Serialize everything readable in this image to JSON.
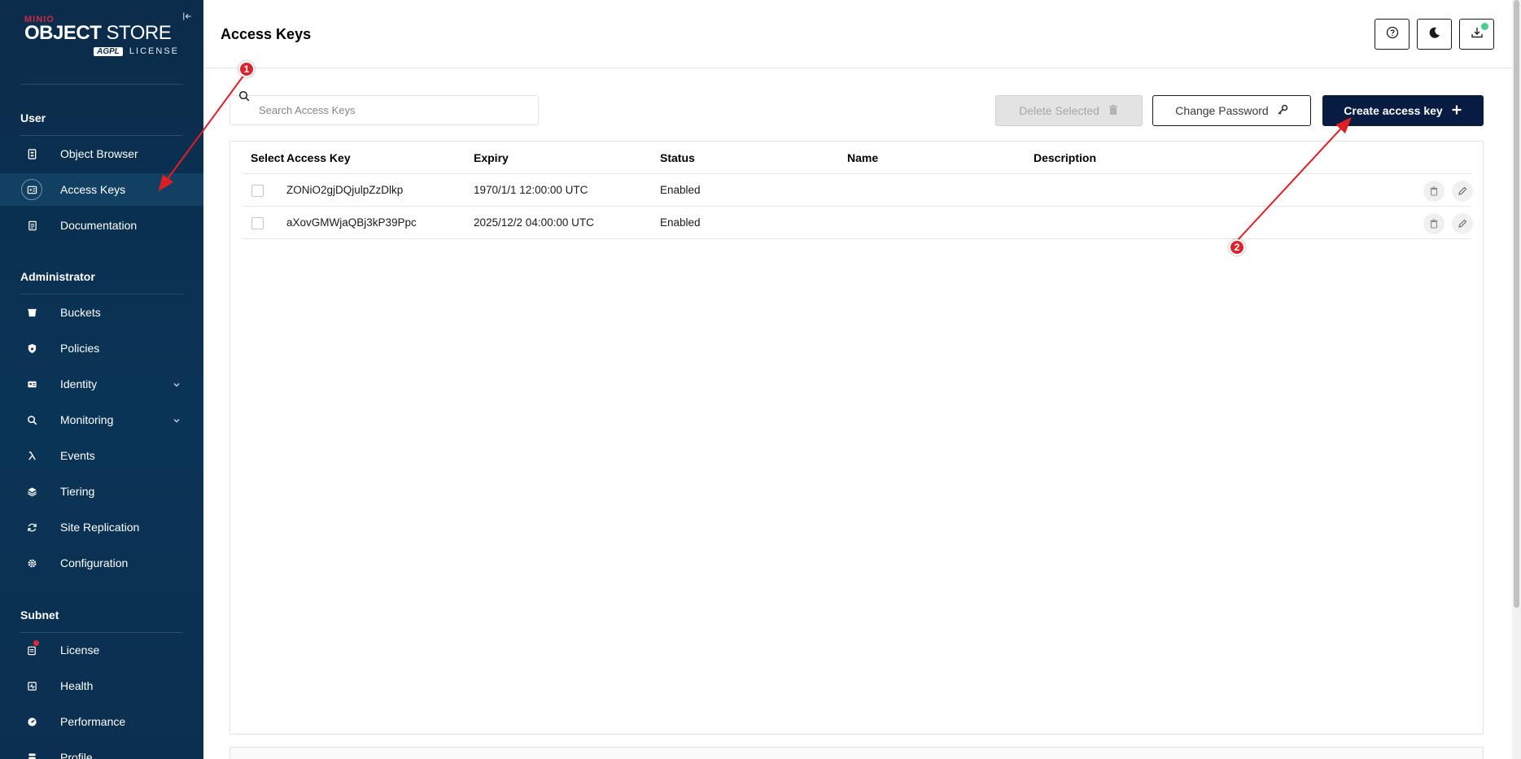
{
  "sidebar": {
    "logo": {
      "brand": "MINIO",
      "title_bold": "OBJECT",
      "title_thin": "STORE",
      "license_badge": "AGPL",
      "license_text": "LICENSE"
    },
    "sections": [
      {
        "title": "User"
      },
      {
        "title": "Administrator"
      },
      {
        "title": "Subnet"
      }
    ],
    "items": [
      {
        "label": "Object Browser",
        "icon": "object-browser-icon"
      },
      {
        "label": "Access Keys",
        "icon": "access-keys-icon",
        "active": true
      },
      {
        "label": "Documentation",
        "icon": "documentation-icon"
      },
      {
        "label": "Buckets",
        "icon": "buckets-icon"
      },
      {
        "label": "Policies",
        "icon": "policies-icon"
      },
      {
        "label": "Identity",
        "icon": "identity-icon",
        "expandable": true
      },
      {
        "label": "Monitoring",
        "icon": "monitoring-icon",
        "expandable": true
      },
      {
        "label": "Events",
        "icon": "lambda-icon"
      },
      {
        "label": "Tiering",
        "icon": "tiering-icon"
      },
      {
        "label": "Site Replication",
        "icon": "site-replication-icon"
      },
      {
        "label": "Configuration",
        "icon": "gear-icon"
      },
      {
        "label": "License",
        "icon": "license-icon",
        "notification": true
      },
      {
        "label": "Health",
        "icon": "health-icon"
      },
      {
        "label": "Performance",
        "icon": "performance-icon"
      },
      {
        "label": "Profile",
        "icon": "profile-icon"
      }
    ]
  },
  "header": {
    "title": "Access Keys",
    "buttons": [
      "help-icon",
      "dark-mode-icon",
      "download-update-icon"
    ]
  },
  "toolbar": {
    "search_placeholder": "Search Access Keys",
    "delete_label": "Delete Selected",
    "change_password_label": "Change Password",
    "create_label": "Create access key"
  },
  "table": {
    "columns": [
      "Select",
      "Access Key",
      "Expiry",
      "Status",
      "Name",
      "Description"
    ],
    "rows": [
      {
        "access_key": "ZONiO2gjDQjulpZzDlkp",
        "expiry": "1970/1/1 12:00:00 UTC",
        "status": "Enabled",
        "name": "",
        "description": ""
      },
      {
        "access_key": "aXovGMWjaQBj3kP39Ppc",
        "expiry": "2025/12/2 04:00:00 UTC",
        "status": "Enabled",
        "name": "",
        "description": ""
      }
    ]
  },
  "annotations": [
    {
      "label": "1"
    },
    {
      "label": "2"
    }
  ],
  "colors": {
    "sidebar_bg": "#0b2c4a",
    "active_item_bg": "#124063",
    "primary_button": "#081c42",
    "annotation_red": "#d9232d",
    "status_green": "#4ccb8d"
  }
}
